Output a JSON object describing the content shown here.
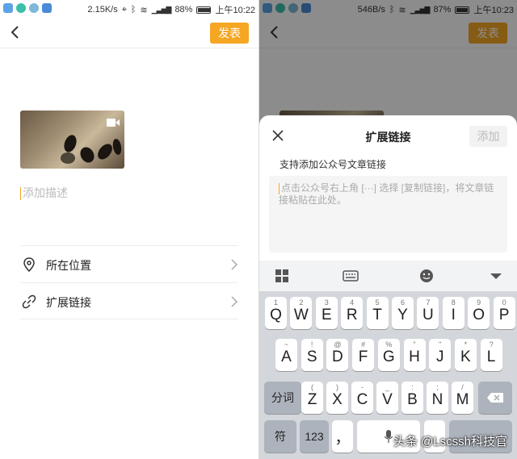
{
  "left": {
    "status": {
      "speed": "2.15K/s",
      "battery": "88%",
      "time": "上午10:22",
      "battery_level": 0.88
    },
    "toolbar": {
      "publish": "发表"
    },
    "description_placeholder": "添加描述",
    "rows": [
      {
        "label": "所在位置",
        "icon": "location-pin-icon"
      },
      {
        "label": "扩展链接",
        "icon": "link-icon"
      }
    ]
  },
  "right": {
    "status": {
      "speed": "546B/s",
      "battery": "87%",
      "time": "上午10:23",
      "battery_level": 0.87
    },
    "toolbar": {
      "publish": "发表"
    },
    "sheet": {
      "title": "扩展链接",
      "add": "添加",
      "subtitle": "支持添加公众号文章链接",
      "placeholder": "点击公众号右上角 [···] 选择 [复制链接]，将文章链接粘贴在此处。"
    },
    "keyboard": {
      "row1": [
        {
          "k": "Q",
          "s": "1"
        },
        {
          "k": "W",
          "s": "2"
        },
        {
          "k": "E",
          "s": "3"
        },
        {
          "k": "R",
          "s": "4"
        },
        {
          "k": "T",
          "s": "5"
        },
        {
          "k": "Y",
          "s": "6"
        },
        {
          "k": "U",
          "s": "7"
        },
        {
          "k": "I",
          "s": "8"
        },
        {
          "k": "O",
          "s": "9"
        },
        {
          "k": "P",
          "s": "0"
        }
      ],
      "row2": [
        {
          "k": "A",
          "s": "~"
        },
        {
          "k": "S",
          "s": "!"
        },
        {
          "k": "D",
          "s": "@"
        },
        {
          "k": "F",
          "s": "#"
        },
        {
          "k": "G",
          "s": "%"
        },
        {
          "k": "H",
          "s": "\""
        },
        {
          "k": "J",
          "s": "\""
        },
        {
          "k": "K",
          "s": "*"
        },
        {
          "k": "L",
          "s": "?"
        }
      ],
      "row3": [
        {
          "k": "Z",
          "s": "("
        },
        {
          "k": "X",
          "s": ")"
        },
        {
          "k": "C",
          "s": "-"
        },
        {
          "k": "V",
          "s": "_"
        },
        {
          "k": "B",
          "s": ":"
        },
        {
          "k": "N",
          "s": ";"
        },
        {
          "k": "M",
          "s": "/"
        }
      ],
      "split": "分词",
      "symbols": "符",
      "numbers": "123",
      "comma": "，"
    }
  },
  "watermark": "头条 @Lscssh科技官"
}
